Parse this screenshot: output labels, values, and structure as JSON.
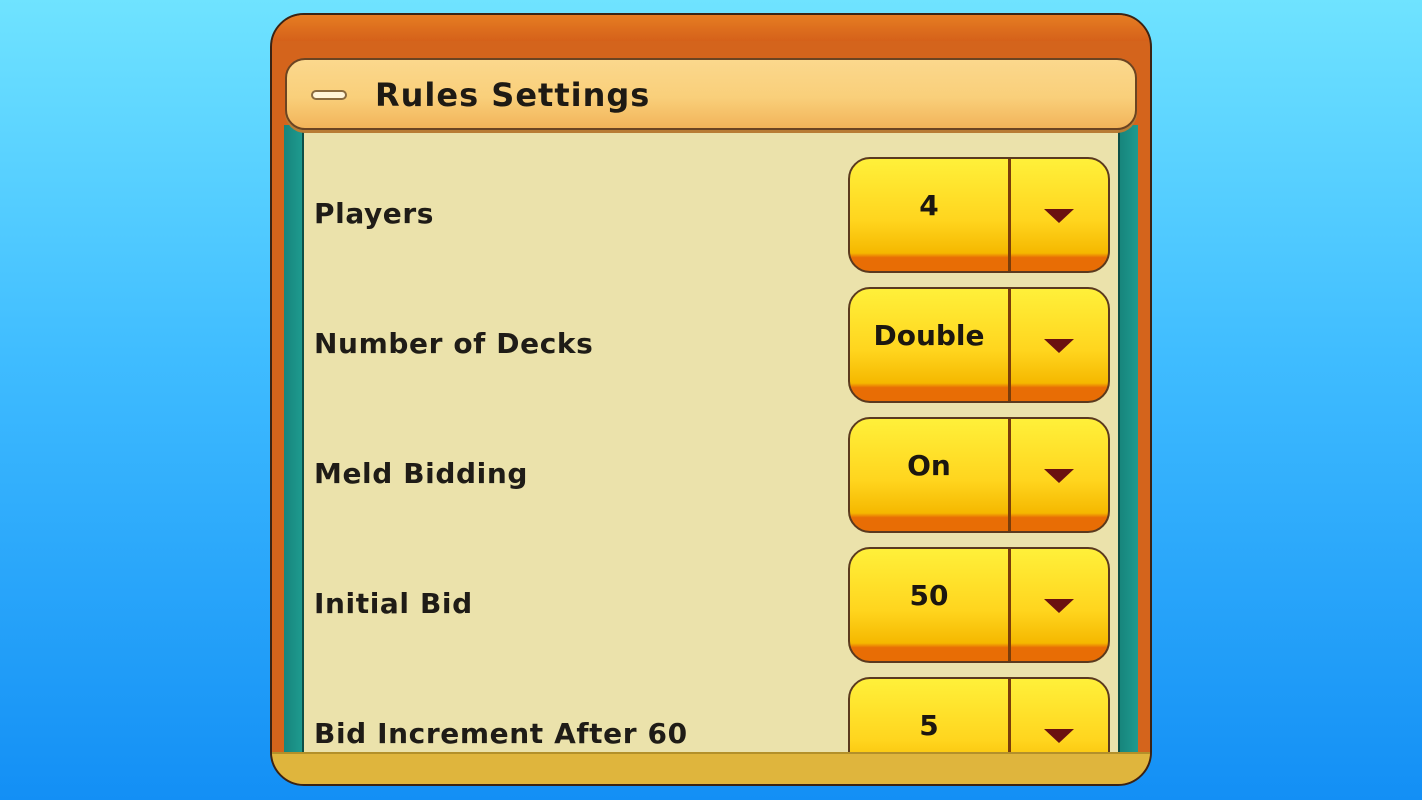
{
  "panel": {
    "title": "Rules Settings",
    "collapse_icon": "minus-icon"
  },
  "settings": [
    {
      "label": "Players",
      "value": "4",
      "icon": "chevron-down-icon"
    },
    {
      "label": "Number of Decks",
      "value": "Double",
      "icon": "chevron-down-icon"
    },
    {
      "label": "Meld Bidding",
      "value": "On",
      "icon": "chevron-down-icon"
    },
    {
      "label": "Initial Bid",
      "value": "50",
      "icon": "chevron-down-icon"
    },
    {
      "label": "Bid Increment After 60",
      "value": "5",
      "icon": "chevron-down-icon"
    }
  ],
  "colors": {
    "frame": "#d4641c",
    "header": "#f9cf7a",
    "content": "#ebe2ab",
    "dropdown": "#ffd51e",
    "arrow": "#6a1010"
  }
}
